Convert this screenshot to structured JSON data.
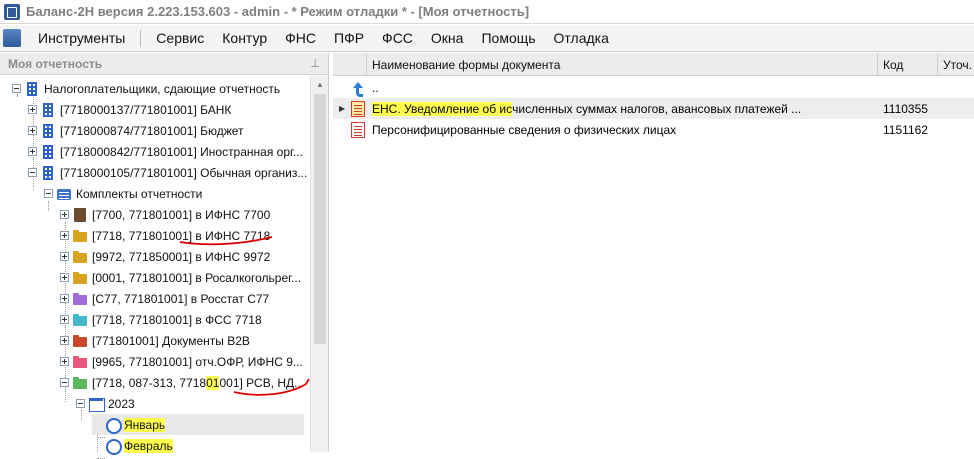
{
  "window": {
    "title": "Баланс-2Н версия 2.223.153.603 - admin  - * Режим отладки * - [Моя отчетность]"
  },
  "menu": {
    "items": [
      "Инструменты",
      "Сервис",
      "Контур",
      "ФНС",
      "ПФР",
      "ФСС",
      "Окна",
      "Помощь",
      "Отладка"
    ]
  },
  "left_panel": {
    "title": "Моя отчетность",
    "pin_icon": "pin-icon",
    "tree": [
      {
        "label": "Налогоплательщики, сдающие отчетность",
        "icon": "buildings-icon"
      },
      {
        "label": "[7718000137/771801001] БАНК",
        "icon": "building-icon"
      },
      {
        "label": "[7718000874/771801001] Бюджет",
        "icon": "building-icon"
      },
      {
        "label": "[7718000842/771801001] Иностранная орг...",
        "icon": "building-icon"
      },
      {
        "label": "[7718000105/771801001] Обычная организ...",
        "icon": "building-icon"
      },
      {
        "label": "Комплекты отчетности",
        "icon": "kits-icon"
      },
      {
        "label": "[7700, 771801001] в ИФНС 7700",
        "icon": "book-icon"
      },
      {
        "label": "[7718, 771801001] в ИФНС 7718",
        "icon": "folder-icon"
      },
      {
        "label": "[9972, 771850001] в ИФНС 9972",
        "icon": "folder-icon"
      },
      {
        "label": "[0001, 771801001] в Росалкогольрег...",
        "icon": "folder-icon"
      },
      {
        "label": "[C77, 771801001] в Росстат C77",
        "icon": "folder-icon"
      },
      {
        "label": "[7718, 771801001] в ФСС 7718",
        "icon": "folder-icon"
      },
      {
        "label": "[771801001] Документы B2B",
        "icon": "folder-icon"
      },
      {
        "label": "[9965, 771801001] отч.ОФР, ИФНС 9...",
        "icon": "folder-icon"
      },
      {
        "label_pre": "[7718, 087-313, 7718",
        "label_hl": "01",
        "label_post": "001] РСВ, НД...",
        "icon": "folder-icon"
      },
      {
        "label": "2023",
        "icon": "calendar-icon"
      },
      {
        "label": "Январь",
        "icon": "month-icon"
      },
      {
        "label": "Февраль",
        "icon": "month-icon"
      }
    ]
  },
  "grid": {
    "columns": [
      "Наименование формы документа",
      "Код",
      "Уточ."
    ],
    "up_row_label": "..",
    "rows": [
      {
        "name_hl": "ЕНС. Уведомление об ис",
        "name_rest": "численных суммах налогов, авансовых платежей ...",
        "code": "1110355",
        "icon": "document-icon"
      },
      {
        "name": "Персонифицированные сведения о физических лицах",
        "code": "1151162",
        "icon": "document-icon"
      }
    ]
  },
  "colors": {
    "highlight": "#ffff4d",
    "annotation": "#e00000",
    "folder_brown": "#6b4a2b",
    "folder_yellow": "#d9a520",
    "folder_purple": "#a26bd6",
    "folder_teal": "#45b7c8",
    "folder_red": "#c9472b",
    "folder_pink": "#e8587a",
    "folder_green": "#5cb85c"
  }
}
